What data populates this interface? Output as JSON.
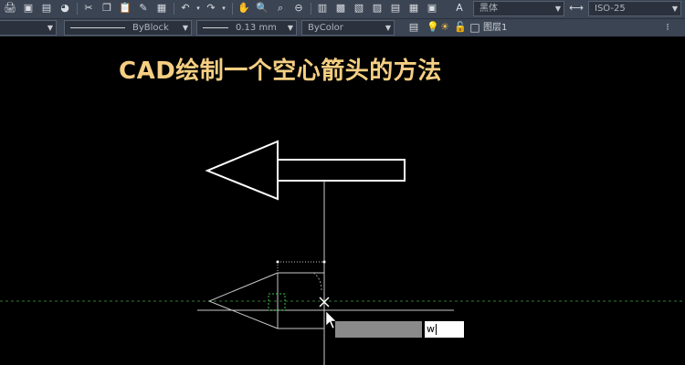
{
  "toolbar": {
    "linetype_value": "ByBlock",
    "lineweight_value": "0.13 mm",
    "color_value": "ByColor",
    "font_value": "黑体",
    "dimstyle_value": "ISO-25",
    "layer_value": "图层1"
  },
  "drawing": {
    "title": "CAD绘制一个空心箭头的方法"
  },
  "dynamic_input": {
    "value": "w"
  },
  "colors": {
    "title": "#f5cf82",
    "background": "#000000",
    "toolbar": "#3b4453"
  }
}
